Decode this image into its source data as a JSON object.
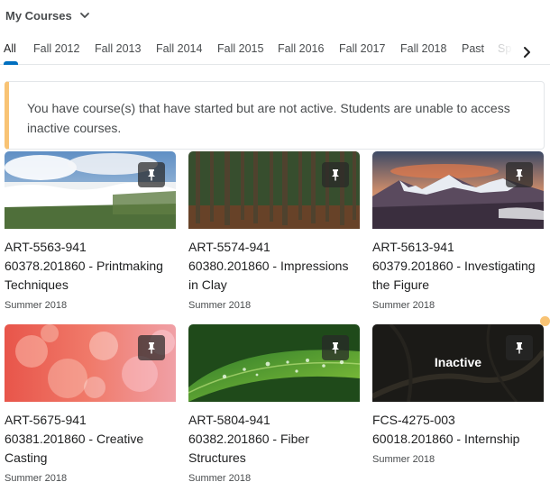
{
  "header": {
    "title": "My Courses",
    "chevron_icon": "chevron-down-icon"
  },
  "tabs": [
    {
      "label": "All",
      "active": true
    },
    {
      "label": "Fall 2012"
    },
    {
      "label": "Fall 2013"
    },
    {
      "label": "Fall 2014"
    },
    {
      "label": "Fall 2015"
    },
    {
      "label": "Fall 2016"
    },
    {
      "label": "Fall 2017"
    },
    {
      "label": "Fall 2018"
    },
    {
      "label": "Past"
    },
    {
      "label": "Sp"
    }
  ],
  "alert": {
    "message": "You have course(s) that have started but are not active. Students are unable to access inactive courses."
  },
  "courses": [
    {
      "code": "ART-5563-941",
      "name": "60378.201860 - Printmaking Techniques",
      "term": "Summer 2018",
      "image": "waterfall"
    },
    {
      "code": "ART-5574-941",
      "name": "60380.201860 - Impressions in Clay",
      "term": "Summer 2018",
      "image": "forest"
    },
    {
      "code": "ART-5613-941",
      "name": "60379.201860 - Investigating the Figure",
      "term": "Summer 2018",
      "image": "mountains"
    },
    {
      "code": "ART-5675-941",
      "name": "60381.201860 - Creative Casting",
      "term": "Summer 2018",
      "image": "bokeh"
    },
    {
      "code": "ART-5804-941",
      "name": "60382.201860 - Fiber Structures",
      "term": "Summer 2018",
      "image": "leaf"
    },
    {
      "code": "FCS-4275-003",
      "name": "60018.201860 - Internship",
      "term": "Summer 2018",
      "image": "dark-branches",
      "status": "Inactive"
    }
  ],
  "colors": {
    "alert_accent": "#f8c374",
    "tab_indicator": "#006fbf",
    "notification_dot": "#f8c374"
  }
}
